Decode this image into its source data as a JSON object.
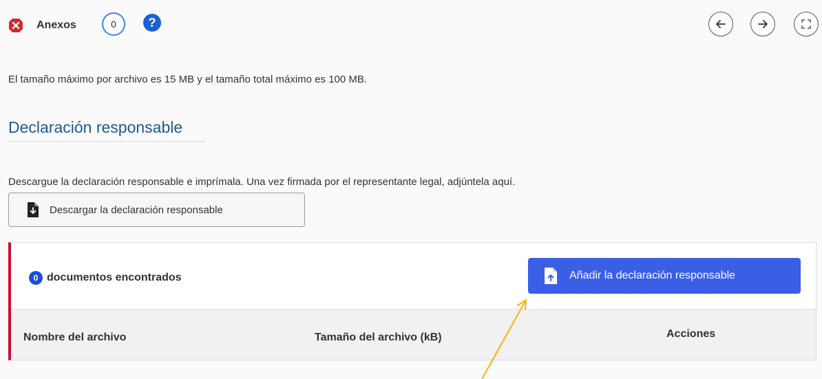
{
  "header": {
    "status_icon": "close-circle-icon",
    "title": "Anexos",
    "count": "0",
    "help_icon": "question-icon",
    "help_glyph": "?",
    "nav": {
      "back_icon": "arrow-left-icon",
      "forward_icon": "arrow-right-icon",
      "expand_icon": "expand-icon"
    }
  },
  "info_text": "El tamaño máximo por archivo es 15 MB y el tamaño total máximo es 100 MB.",
  "section": {
    "title": "Declaración responsable",
    "instructions": "Descargue la declaración responsable e imprímala. Una vez firmada por el representante legal, adjúntela aquí.",
    "download_button": "Descargar la declaración responsable"
  },
  "documents": {
    "count": "0",
    "found_label": "documentos encontrados",
    "add_button": "Añadir la declaración responsable",
    "columns": [
      "Nombre del archivo",
      "Tamaño del archivo (kB)",
      "Acciones"
    ]
  },
  "colors": {
    "accent": "#3a5fe5",
    "danger": "#c8102e",
    "title": "#1f5a8f",
    "annotation": "#f5b700"
  }
}
